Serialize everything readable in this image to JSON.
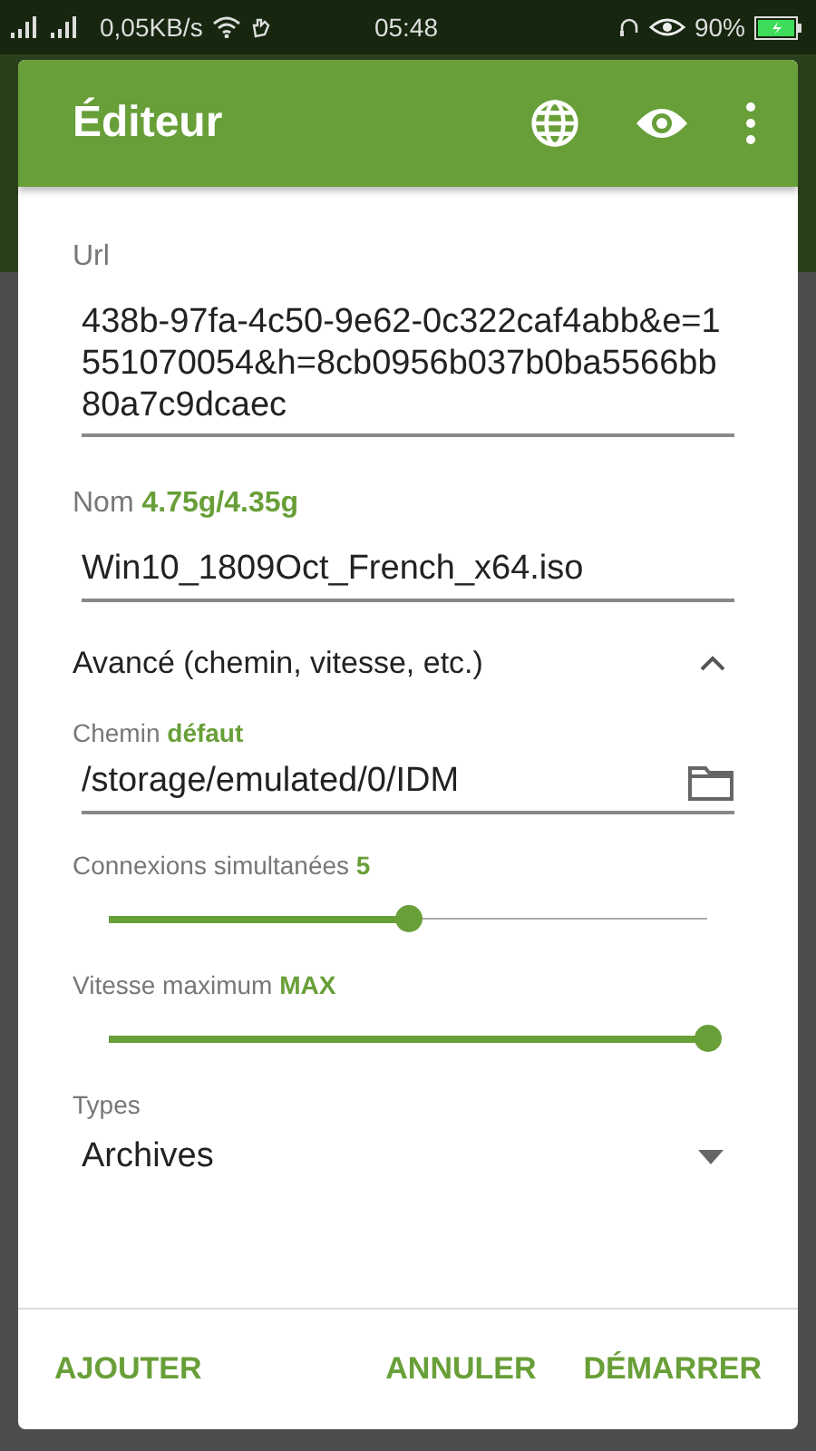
{
  "status_bar": {
    "speed": "0,05KB/s",
    "time": "05:48",
    "battery": "90%"
  },
  "dialog": {
    "title": "Éditeur",
    "url": {
      "label": "Url",
      "value": "438b-97fa-4c50-9e62-0c322caf4abb&e=1551070054&h=8cb0956b037b0ba5566bb80a7c9dcaec"
    },
    "name": {
      "label": "Nom",
      "hint": "4.75g/4.35g",
      "value": "Win10_1809Oct_French_x64.iso"
    },
    "advanced": {
      "label": "Avancé (chemin, vitesse, etc.)",
      "expanded": true
    },
    "path": {
      "label": "Chemin",
      "hint": "défaut",
      "value": "/storage/emulated/0/IDM"
    },
    "sliders": [
      {
        "label": "Connexions simultanées",
        "reading": "5",
        "level": 0.5
      },
      {
        "label": "Vitesse maximum",
        "reading": "MAX",
        "level": 1.0
      }
    ],
    "types": {
      "label": "Types",
      "value": "Archives"
    },
    "buttons": [
      {
        "label": "AJOUTER"
      },
      {
        "label": "ANNULER"
      },
      {
        "label": "DÉMARRER"
      }
    ]
  }
}
